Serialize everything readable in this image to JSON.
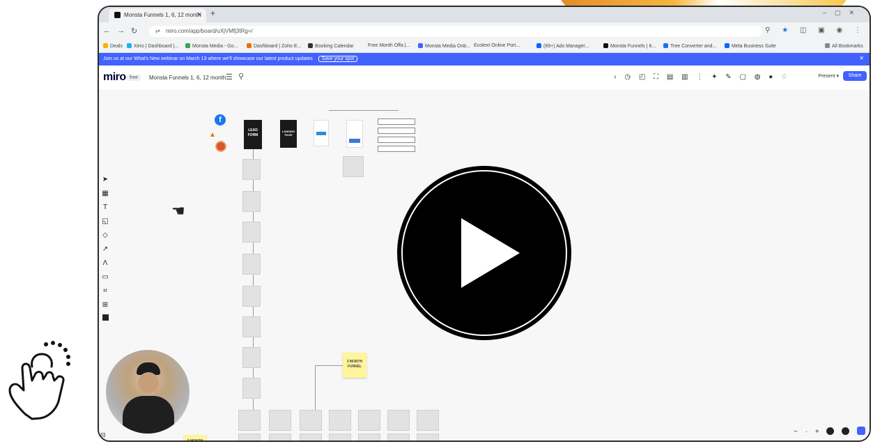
{
  "browser": {
    "tab_title": "Monsta Funnels 1, 6, 12 month",
    "url": "miro.com/app/board/uXjVMfj3tRg=/",
    "bookmarks": [
      "Deals",
      "Xero | Dashboard |...",
      "Monsta Media - Go...",
      "Dashboard | Zoho E...",
      "Booking Calendar",
      "Free Month Offa |...",
      "Monsta Media Onb...",
      "Ecotext Online Port...",
      "(69+) Ads Manager...",
      "Monsta Funnels | 6...",
      "Tree Converter and...",
      "Meta Business Suite"
    ],
    "all_bookmarks": "All Bookmarks"
  },
  "banner": {
    "text": "Join us at our What's New webinar on March 13 where we'll showcase our latest product updates",
    "cta": "Save your spot"
  },
  "miro": {
    "logo": "miro",
    "plan": "free",
    "board_name": "Monsta Funnels 1, 6, 12 month",
    "present": "Present",
    "share": "Share"
  },
  "board": {
    "lead_form": "LEAD FORM",
    "landing_page": "LANDING PAGE",
    "sticky_3month": "3 MONTH FUNNEL",
    "sticky_6month": "6 MONTH"
  },
  "colors": {
    "miro_blue": "#4262ff",
    "play_button": "#000000",
    "sticky_yellow": "#fff59a"
  },
  "icons": [
    "play-icon",
    "click-hand-icon",
    "facebook-icon",
    "instagram-icon",
    "hand-cursor-icon"
  ]
}
